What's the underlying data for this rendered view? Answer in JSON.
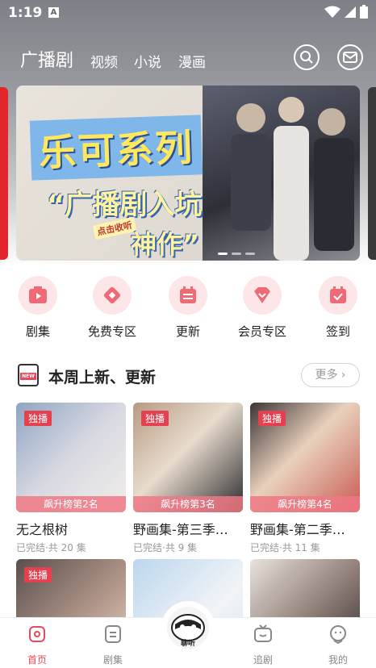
{
  "status_bar": {
    "time": "1:19",
    "notif_letter": "A"
  },
  "top_nav": {
    "tabs": [
      {
        "label": "广播剧",
        "active": true
      },
      {
        "label": "视频"
      },
      {
        "label": "小说"
      },
      {
        "label": "漫画"
      }
    ]
  },
  "banner": {
    "title": "乐可系列",
    "subtitle_line1": "“广播剧入坑",
    "subtitle_line2": "神作”",
    "tag": "点击收听",
    "page_count": 3,
    "active_page": 1
  },
  "quick_menu": [
    {
      "label": "剧集",
      "icon": "play-icon"
    },
    {
      "label": "免费专区",
      "icon": "diamond-icon"
    },
    {
      "label": "更新",
      "icon": "calendar-list-icon"
    },
    {
      "label": "会员专区",
      "icon": "vip-heart-icon"
    },
    {
      "label": "签到",
      "icon": "checkin-icon"
    }
  ],
  "section": {
    "title": "本周上新、更新",
    "more": "更多 ›",
    "icon_text": "NEW"
  },
  "cards": [
    {
      "badge": "独播",
      "rank": "飙升榜第2名",
      "title": "无之根树",
      "meta": "已完结·共 20 集"
    },
    {
      "badge": "独播",
      "rank": "飙升榜第3名",
      "title": "野画集-第三季…",
      "meta": "已完结·共 9 集"
    },
    {
      "badge": "独播",
      "rank": "飙升榜第4名",
      "title": "野画集-第二季…",
      "meta": "已完结·共 11 集"
    },
    {
      "badge": "独播",
      "rank": "",
      "title": "",
      "meta": ""
    },
    {
      "badge": "",
      "rank": "",
      "title": "",
      "meta": ""
    },
    {
      "badge": "",
      "rank": "",
      "title": "",
      "meta": ""
    }
  ],
  "bottom_nav": {
    "items": [
      {
        "label": "首页",
        "active": true
      },
      {
        "label": "剧集"
      },
      {
        "label": "追剧"
      },
      {
        "label": "我的"
      }
    ],
    "center_label": "聊听"
  },
  "colors": {
    "accent": "#e74a5b",
    "badge": "#e5404f",
    "rank_bar": "#ef7885"
  }
}
